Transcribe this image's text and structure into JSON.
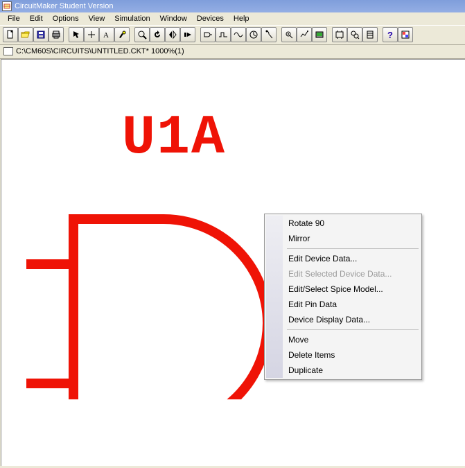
{
  "titlebar": {
    "title": "CircuitMaker Student Version"
  },
  "menubar": {
    "file": "File",
    "edit": "Edit",
    "options": "Options",
    "view": "View",
    "simulation": "Simulation",
    "window": "Window",
    "devices": "Devices",
    "help": "Help"
  },
  "docbar": {
    "path": "C:\\CM60S\\CIRCUITS\\UNTITLED.CKT* 1000%(1)"
  },
  "component": {
    "label": "U1A"
  },
  "context_menu": {
    "rotate90": "Rotate 90",
    "mirror": "Mirror",
    "editDeviceData": "Edit Device Data...",
    "editSelectedDeviceData": "Edit Selected Device Data...",
    "editSelectSpiceModel": "Edit/Select Spice Model...",
    "editPinData": "Edit Pin Data",
    "deviceDisplayData": "Device Display Data...",
    "move": "Move",
    "deleteItems": "Delete Items",
    "duplicate": "Duplicate"
  }
}
